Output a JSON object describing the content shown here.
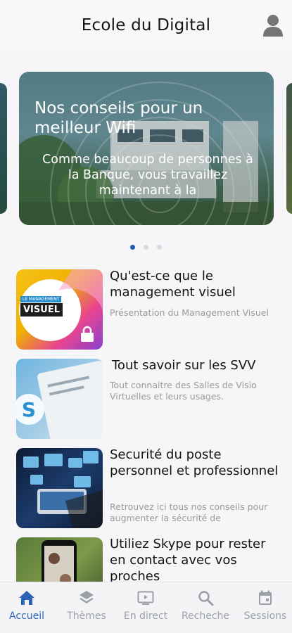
{
  "header": {
    "title": "Ecole du Digital"
  },
  "carousel": {
    "title": "Nos conseils pour un meilleur Wifi",
    "text": "Comme beaucoup de personnes à la Banque, vous travaillez maintenant à la",
    "page_count": 3,
    "active_index": 0
  },
  "articles": [
    {
      "title": "Qu'est-ce que le management visuel",
      "description": "Présentation du Management Visuel",
      "thumb_badge_top": "LE MANAGEMENT",
      "thumb_badge": "VISUEL",
      "locked": true
    },
    {
      "title": "Tout savoir sur les SVV",
      "description": "Tout connaitre des Salles de Visio Virtuelles et leurs usages."
    },
    {
      "title": "Securité du poste personnel et professionnel",
      "description": "Retrouvez ici tous nos conseils pour augmenter la sécurité de"
    },
    {
      "title": "Utiliez Skype pour rester en contact avec vos proches",
      "description": ""
    }
  ],
  "tabbar": {
    "items": [
      {
        "label": "Accueil",
        "icon": "home-icon",
        "active": true
      },
      {
        "label": "Thèmes",
        "icon": "layers-icon",
        "active": false
      },
      {
        "label": "En direct",
        "icon": "live-video-icon",
        "active": false
      },
      {
        "label": "Recheche",
        "icon": "search-icon",
        "active": false
      },
      {
        "label": "Sessions",
        "icon": "calendar-icon",
        "active": false
      }
    ]
  },
  "colors": {
    "accent": "#2a64b6",
    "inactive": "#9aa0a8",
    "dot_active": "#1f5bb0"
  }
}
